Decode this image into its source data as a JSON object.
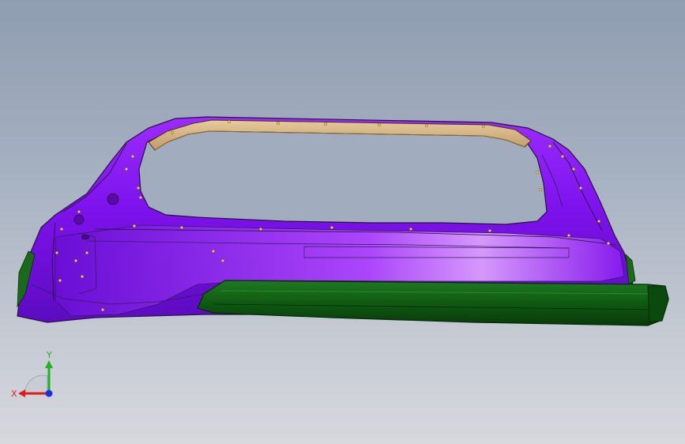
{
  "viewport": {
    "background_top": "#8f9db1",
    "background_bottom": "#d6d8dd"
  },
  "model": {
    "panel_color": "#8a16f0",
    "panel_highlight": "#c36bff",
    "sill_color": "#0f5a12",
    "header_color": "#d8b98a",
    "fastener_color": "#e6c65a",
    "edge_color": "#2b1140"
  },
  "triad": {
    "x_label": "X",
    "y_label": "Y",
    "x_color": "#e21b1b",
    "y_color": "#22b222",
    "z_color": "#1f2fe0"
  }
}
